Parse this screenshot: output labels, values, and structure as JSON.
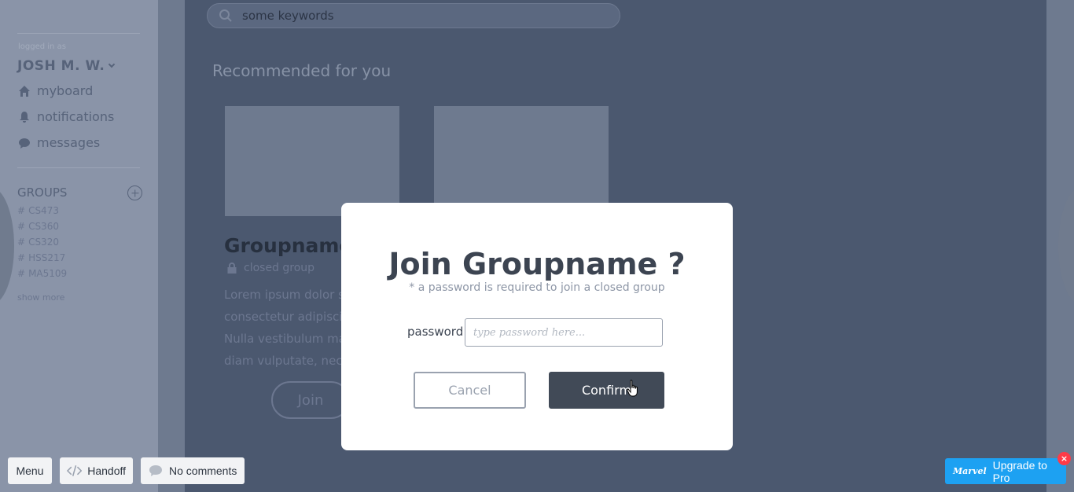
{
  "sidebar": {
    "logged_label": "logged in as",
    "username": "JOSH M. W.",
    "nav": [
      {
        "label": "myboard",
        "icon": "home-icon"
      },
      {
        "label": "notifications",
        "icon": "bell-icon"
      },
      {
        "label": "messages",
        "icon": "chat-icon"
      }
    ],
    "groups_title": "GROUPS",
    "groups": [
      "CS473",
      "CS360",
      "CS320",
      "HSS217",
      "MA5109"
    ],
    "show_more": "show more"
  },
  "search": {
    "value": "some keywords"
  },
  "main": {
    "section_title": "Recommended for you",
    "card": {
      "group_name": "Groupname",
      "status": "closed group",
      "lorem": [
        "Lorem ipsum dolor sit",
        "consectetur adipiscin",
        "Nulla vestibulum ma",
        "diam vulputate, nec"
      ],
      "join_label": "Join"
    }
  },
  "modal": {
    "title": "Join Groupname ?",
    "subtitle": "* a password is required to join a closed group",
    "password_label": "password",
    "password_placeholder": "type password here...",
    "cancel_label": "Cancel",
    "confirm_label": "Confirm"
  },
  "toolbar": {
    "menu_label": "Menu",
    "handoff_label": "Handoff",
    "comments_label": "No comments",
    "upgrade_logo": "Marvel",
    "upgrade_label": "Upgrade to Pro",
    "close_glyph": "×"
  },
  "colors": {
    "accent": "#1da1f2",
    "confirm_bg": "#414a57",
    "overlay_bg": "#49556b"
  }
}
